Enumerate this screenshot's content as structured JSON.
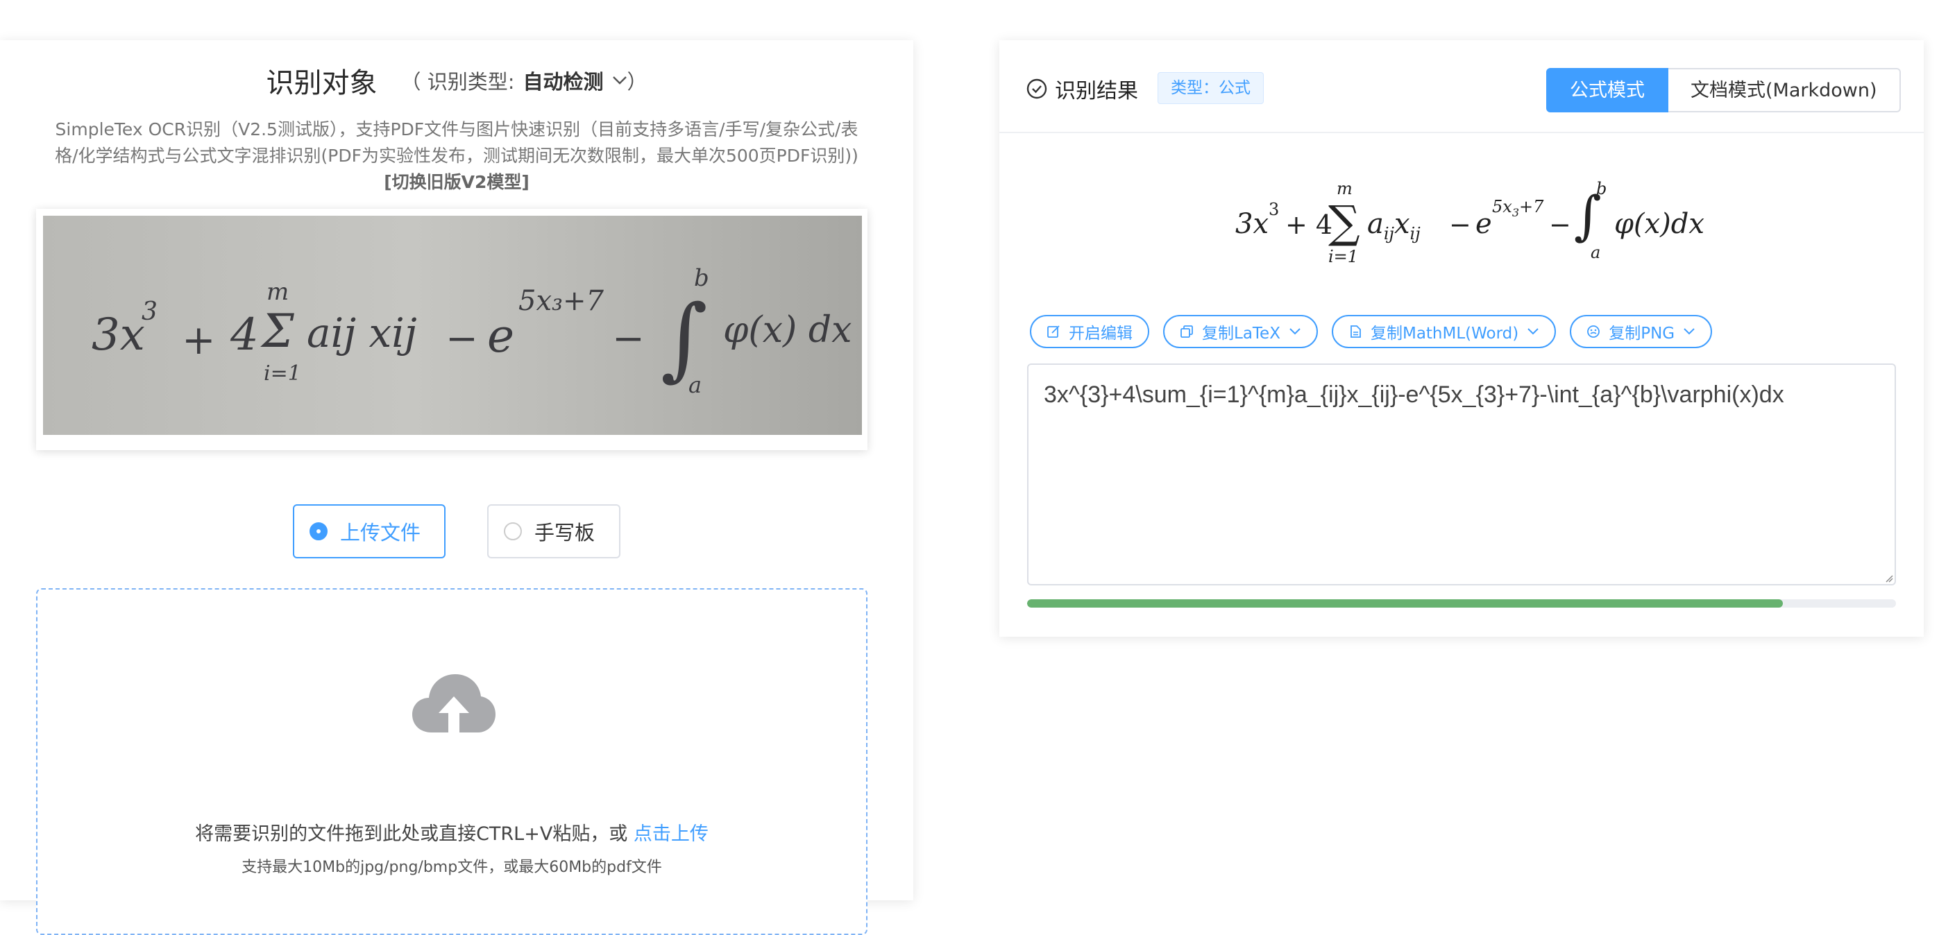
{
  "left": {
    "title": "识别对象",
    "type_prefix": "（ 识别类型:",
    "type_value": "自动检测",
    "type_suffix": "）",
    "description_line1": "SimpleTex OCR识别（V2.5测试版），支持PDF文件与图片快速识别（目前支持多语言/手写/复杂公式/表",
    "description_line2": "格/化学结构式与公式文字混排识别(PDF为实验性发布，测试期间无次数限制，最大单次500页PDF识别))",
    "switch_link": "[切换旧版V2模型]",
    "modes": {
      "upload": "上传文件",
      "handwriting": "手写板"
    },
    "dropzone": {
      "text": "将需要识别的文件拖到此处或直接CTRL+V粘贴，或",
      "link": "点击上传",
      "sub": "支持最大10Mb的jpg/png/bmp文件，或最大60Mb的pdf文件"
    }
  },
  "right": {
    "title": "识别结果",
    "badge": "类型：公式",
    "tabs": {
      "formula": "公式模式",
      "document": "文档模式(Markdown)"
    },
    "actions": {
      "edit": "开启编辑",
      "copy_latex": "复制LaTeX",
      "copy_mathml": "复制MathML(Word)",
      "copy_png": "复制PNG"
    },
    "latex": "3x^{3}+4\\sum_{i=1}^{m}a_{ij}x_{ij}-e^{5x_{3}+7}-\\int_{a}^{b}\\varphi(x)dx",
    "progress_fraction": 0.87
  },
  "colors": {
    "accent": "#409eff",
    "progress": "#67b26f",
    "dropzone_border": "#7fb3f5"
  },
  "icons": [
    "chevron-down-icon",
    "cloud-upload-icon",
    "check-circle-icon",
    "edit-icon",
    "copy-icon",
    "document-icon",
    "image-icon",
    "resize-grip-icon"
  ]
}
